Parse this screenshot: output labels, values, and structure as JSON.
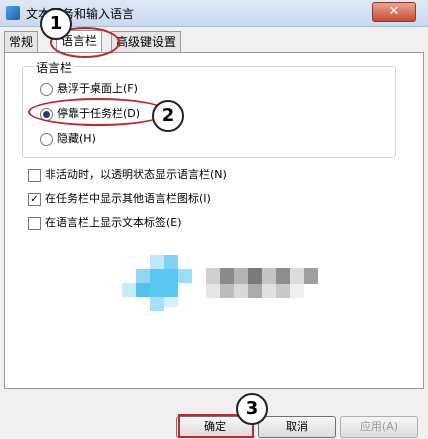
{
  "window": {
    "title": "文本服务和输入语言",
    "close_glyph": "✕"
  },
  "tabs": [
    {
      "label": "常规"
    },
    {
      "label": "语言栏"
    },
    {
      "label": "高级键设置"
    }
  ],
  "language_bar_group": {
    "title": "语言栏",
    "options": [
      {
        "label": "悬浮于桌面上(F)",
        "selected": false
      },
      {
        "label": "停靠于任务栏(D)",
        "selected": true
      },
      {
        "label": "隐藏(H)",
        "selected": false
      }
    ]
  },
  "checkboxes": [
    {
      "label": "非活动时，以透明状态显示语言栏(N)",
      "checked": false
    },
    {
      "label": "在任务栏中显示其他语言栏图标(I)",
      "checked": true
    },
    {
      "label": "在语言栏上显示文本标签(E)",
      "checked": false
    }
  ],
  "annotations": {
    "step1": "1",
    "step2": "2",
    "step3": "3"
  },
  "buttons": {
    "ok": "确定",
    "cancel": "取消",
    "apply": "应用(A)"
  },
  "colors": {
    "annotation_red": "#c0282a",
    "mosaic_cyan": "#5ac8f0"
  }
}
